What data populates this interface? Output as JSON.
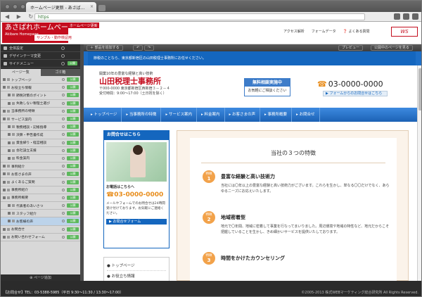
{
  "browser": {
    "tab_title": "ホームページ更新 - あさば…",
    "url": "https",
    "nav_glyphs": "◀ ▶ ↻"
  },
  "app": {
    "logo_title": "あさばれホームページ",
    "logo_sub": "Akibare Homepage",
    "sample_badge": "サンプル・動作検証用",
    "red_tab": "ホームページ更新",
    "header_links": [
      "アクセス解析",
      "フォームデータ",
      "よくある質問"
    ],
    "brand_mark": "WS"
  },
  "sidebar": {
    "top_rows": [
      {
        "label": "全体設定",
        "status": ""
      },
      {
        "label": "デザインテーマ変更",
        "status": ""
      },
      {
        "label": "サイドメニュー",
        "status": "公開"
      }
    ],
    "tabs": [
      "ページ一覧",
      "ゴミ箱"
    ],
    "pages": [
      {
        "label": "トップページ",
        "sub": false,
        "pub": "公開"
      },
      {
        "label": "お役立ち情報",
        "sub": false,
        "pub": "公開"
      },
      {
        "label": "節税対策のポイント",
        "sub": true,
        "pub": "公開"
      },
      {
        "label": "失敗しない税理士選び",
        "sub": true,
        "pub": "公開"
      },
      {
        "label": "当事務所の特徴",
        "sub": false,
        "pub": "公開"
      },
      {
        "label": "サービス案内",
        "sub": false,
        "pub": "公開"
      },
      {
        "label": "税務相談・記帳指導",
        "sub": true,
        "pub": "公開"
      },
      {
        "label": "決算・申告書作成",
        "sub": true,
        "pub": "公開"
      },
      {
        "label": "資金繰り・経営相談",
        "sub": true,
        "pub": "公開"
      },
      {
        "label": "会社設立支援",
        "sub": true,
        "pub": "公開"
      },
      {
        "label": "料金案内",
        "sub": true,
        "pub": "公開"
      },
      {
        "label": "事例紹介",
        "sub": false,
        "pub": "公開"
      },
      {
        "label": "お客さまの声",
        "sub": false,
        "pub": "公開"
      },
      {
        "label": "よくあるご質問",
        "sub": false,
        "pub": "公開"
      },
      {
        "label": "事務所紹介",
        "sub": false,
        "pub": "公開"
      },
      {
        "label": "事務所概要",
        "sub": false,
        "pub": "公開"
      },
      {
        "label": "代表者のあいさつ",
        "sub": true,
        "pub": "公開"
      },
      {
        "label": "スタッフ紹介",
        "sub": true,
        "pub": "公開"
      },
      {
        "label": "お客様の声",
        "sub": true,
        "pub": "公開",
        "selected": true
      },
      {
        "label": "お問合せ",
        "sub": false,
        "pub": "公開"
      },
      {
        "label": "お問い合わせフォーム",
        "sub": false,
        "pub": "公開"
      }
    ],
    "add_page": "ページ追加"
  },
  "toolbar": {
    "add_parts": "部品を追加する",
    "undo": "↶",
    "redo": "↷",
    "preview": "プレビュー",
    "publish": "公開中のページを見る"
  },
  "banner": {
    "text": "節税のことなら、東京都新宿区の山田税理士事務所にお任せください。"
  },
  "site": {
    "tagline": "開業10年の豊富な経験と高い技術",
    "firm_name": "山田税理士事務所",
    "address": "〒000-0000 東京都新宿区西新宿３－２－４",
    "hours": "受付時間：9:00～17:00（土日祝を除く）",
    "consult_head": "無料相談実施中",
    "consult_body": "お気軽にご相談ください",
    "phone": "03-0000-0000",
    "form_link": "フォームからのお問合せはこちら",
    "nav": [
      "トップページ",
      "当事務所の特徴",
      "サービス案内",
      "料金案内",
      "お客さまの声",
      "事務所概要",
      "お問合せ"
    ],
    "inquiry_title": "お問合せはこちら",
    "inquiry_phone_label": "お電話はこちらへ",
    "inquiry_phone": "03-0000-0000",
    "inquiry_copy": "メールやフォームでのお問合せは24時間受け付けております。お気軽にご連絡ください。",
    "inquiry_form_btn": "お問合せフォーム",
    "left_menu": [
      "トップページ",
      "お役立ち情報"
    ],
    "section_title": "当社の３つの特徴",
    "features": [
      {
        "label": "特徴",
        "num": "1",
        "title": "豊富な経験と高い技術力",
        "desc": "当社には〇年以上の豊富な経験と高い技術力がございます。これらを生かし、単なる〇〇だけでなく、あらゆるニーズにお応えいたします。"
      },
      {
        "label": "特徴",
        "num": "2",
        "title": "地域密着型",
        "desc": "地元で〇年間、地域に密着して事業を行なってまいりました。周辺環境や地域の特性など、地元だからこそ把握していることを生かし、きめ細かいサービスを提供いたしております。"
      },
      {
        "label": "特徴",
        "num": "3",
        "title": "時間をかけたカウンセリング",
        "desc": ""
      }
    ]
  },
  "footer": {
    "left": "【お問合せ】TEL：03-5388-5985（平日 9:30〜11:30 / 13:30〜17:00）",
    "right": "©2005-2013 株式WEBマーケティング総合研究所 All Rights Reserved."
  }
}
